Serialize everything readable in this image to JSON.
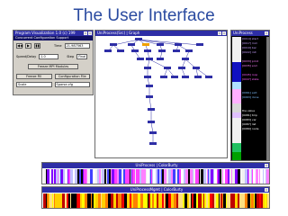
{
  "slide": {
    "title": "The User Interface"
  },
  "control": {
    "title": "Program Visualization 1.0 (c) 199",
    "subtitle": "Concurrent Configuration Support",
    "play_buttons": [
      "◀◀",
      "▶",
      "▮▮"
    ],
    "time_label": "Time",
    "time_value": "21.987563",
    "speed_label": "Speed/Delay",
    "speed_value": "1.0",
    "step_label": "Step",
    "step_value": "Final",
    "freeze_button": "Freeze MPI Modules",
    "freeze_fill_button": "Freeze Fill",
    "config_button": "Configuration File",
    "state_label": "Scale",
    "state_value": "Sparse.cfg"
  },
  "graph": {
    "title": "UniProcess(Src) | Graph"
  },
  "varlist": {
    "title": "UniProcess",
    "items": [
      {
        "label": "[0014] start",
        "color": "#c8a0ff"
      },
      {
        "label": "[0017] mid",
        "color": "#c8a0ff"
      },
      {
        "label": "[0019] bar",
        "color": "#c8a0ff"
      },
      {
        "label": "[0022] init",
        "color": "#c8a0ff"
      },
      {
        "label": "",
        "color": "#c8a0ff"
      },
      {
        "label": "[0033] print",
        "color": "#ff80ff"
      },
      {
        "label": "[0035] end",
        "color": "#ff80ff"
      },
      {
        "label": "",
        "color": "#ff80ff"
      },
      {
        "label": "[0045] loop",
        "color": "#ff60ff"
      },
      {
        "label": "[0047] state",
        "color": "#ff60ff"
      },
      {
        "label": "",
        "color": "#ff60ff"
      },
      {
        "label": "",
        "color": "#ff60ff"
      },
      {
        "label": "[0061] exit",
        "color": "#80c0ff"
      },
      {
        "label": "[0063] done",
        "color": "#80c0ff"
      },
      {
        "label": "",
        "color": "#ffffff"
      },
      {
        "label": "",
        "color": "#ffffff"
      },
      {
        "label": "the value",
        "color": "#ffffff"
      },
      {
        "label": "[0081] tmp",
        "color": "#ffffff"
      },
      {
        "label": "[0083] var",
        "color": "#ffffff"
      },
      {
        "label": "[0087] list",
        "color": "#ffffff"
      },
      {
        "label": "[0089] node",
        "color": "#ffffff"
      },
      {
        "label": "",
        "color": "#ffffff"
      },
      {
        "label": "",
        "color": "#ffffff"
      },
      {
        "label": "",
        "color": "#ffffff"
      },
      {
        "label": "",
        "color": "#ffffff"
      },
      {
        "label": "",
        "color": "#ffffff"
      },
      {
        "label": "",
        "color": "#ffffff"
      }
    ]
  },
  "strip1": {
    "title": "UniProcess | ColorBurty"
  },
  "strip2": {
    "title": "UniProcessMgmt | ColorBurty"
  },
  "colors": {
    "title_text": "#2a4aa0",
    "titlebar": "#2e2ea6",
    "graph_node": "#2e2ea6",
    "highlight_node": "#f0a000"
  }
}
